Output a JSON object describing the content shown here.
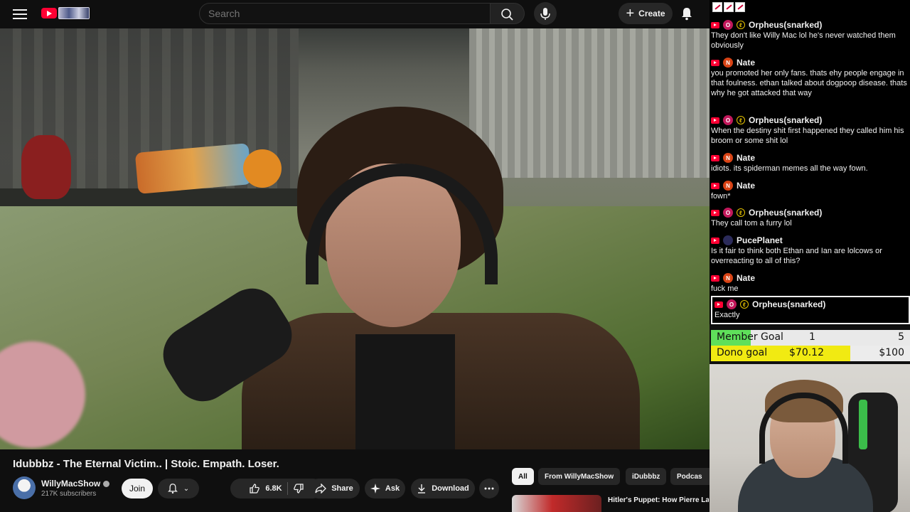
{
  "header": {
    "search_placeholder": "Search",
    "create_label": "Create"
  },
  "video": {
    "title": "Idubbbz - The Eternal Victim.. | Stoic. Empath. Loser.",
    "channel": "WillyMacShow",
    "subscribers": "217K subscribers",
    "join_label": "Join",
    "likes": "6.8K",
    "share_label": "Share",
    "ask_label": "Ask",
    "download_label": "Download"
  },
  "chips": [
    "All",
    "From WillyMacShow",
    "iDubbbz",
    "Podcas"
  ],
  "recommendation": {
    "title": "Hitler's Puppet: How Pierre Laval Became The Most Hated"
  },
  "chat": {
    "messages": [
      {
        "name": "Orpheus(snarked)",
        "avatar": "O",
        "avatar_color": "#c2185b",
        "badge": true,
        "text": "They don't like Willy Mac lol he's never watched them obviously"
      },
      {
        "name": "Nate",
        "avatar": "N",
        "avatar_color": "#d84315",
        "badge": false,
        "text": "you promoted her only fans. thats ehy people engage in that foulness. ethan talked about dogpoop disease. thats why he got attacked that way"
      },
      {
        "name": "Orpheus(snarked)",
        "avatar": "O",
        "avatar_color": "#c2185b",
        "badge": true,
        "text": "When the destiny shit first happened they called him his broom or some shit lol"
      },
      {
        "name": "Nate",
        "avatar": "N",
        "avatar_color": "#d84315",
        "badge": false,
        "text": "idiots. its spiderman memes all the way fown."
      },
      {
        "name": "Nate",
        "avatar": "N",
        "avatar_color": "#d84315",
        "badge": false,
        "text": "fown*"
      },
      {
        "name": "Orpheus(snarked)",
        "avatar": "O",
        "avatar_color": "#c2185b",
        "badge": true,
        "text": "They call tom a furry lol"
      },
      {
        "name": "PucePlanet",
        "avatar": "",
        "avatar_color": "#2b2b5a",
        "badge": false,
        "text": "Is it fair to think both Ethan and Ian are lolcows or overreacting to all of this?"
      },
      {
        "name": "Nate",
        "avatar": "N",
        "avatar_color": "#d84315",
        "badge": false,
        "text": "fuck me"
      }
    ],
    "highlight": {
      "name": "Orpheus(snarked)",
      "avatar": "O",
      "avatar_color": "#c2185b",
      "text": "Exactly"
    }
  },
  "goals": {
    "member": {
      "label": "Member Goal",
      "current": "1",
      "target": "5",
      "progress": 0.2
    },
    "dono": {
      "label": "Dono goal",
      "current": "$70.12",
      "target": "$100",
      "progress": 0.7012
    }
  },
  "colors": {
    "accent_red": "#ff0033",
    "member_fill": "#5fe05a",
    "dono_fill": "#f1ea12"
  }
}
